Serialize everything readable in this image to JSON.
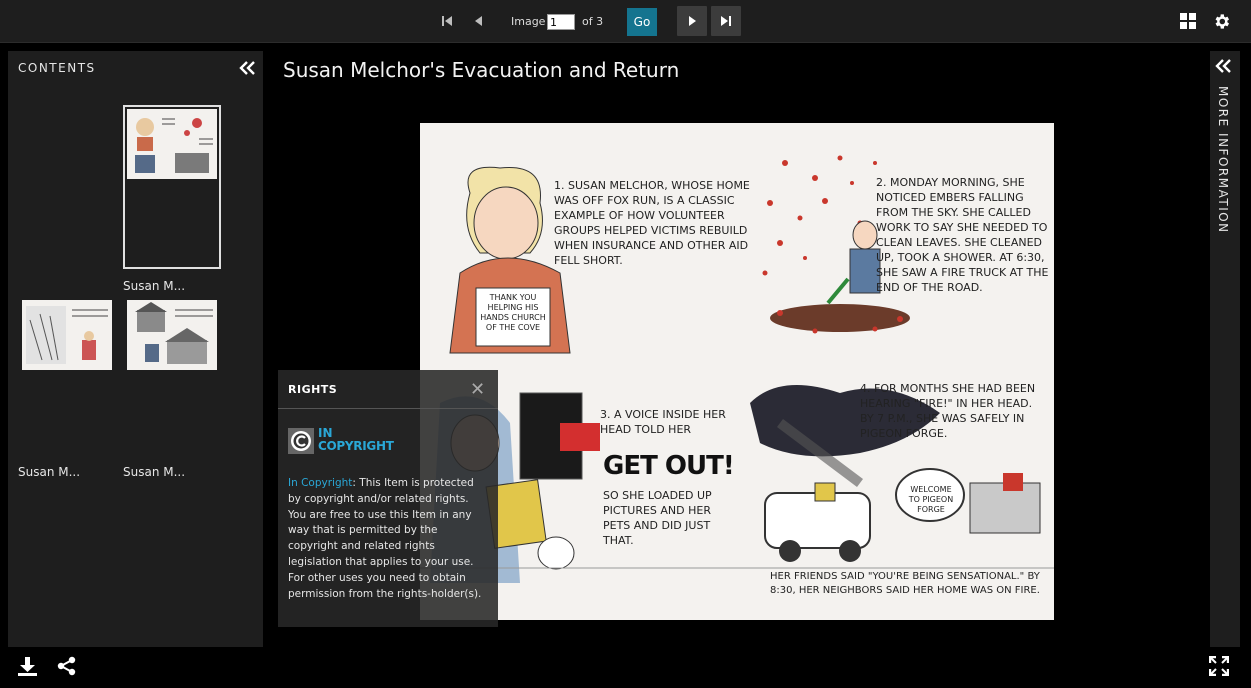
{
  "toolbar": {
    "image_label": "Image",
    "image_value": "1",
    "of_label": "of 3",
    "go_label": "Go"
  },
  "contents": {
    "title": "CONTENTS",
    "items": [
      {
        "label": "Susan M..."
      },
      {
        "label": "Susan M..."
      },
      {
        "label": "Susan M..."
      }
    ]
  },
  "document": {
    "title": "Susan Melchor's Evacuation and Return"
  },
  "artwork": {
    "panel1": "1. Susan Melchor, whose home was off Fox Run, is a classic example of how volunteer groups helped victims rebuild when insurance and other aid fell short.",
    "sign": "Thank you Helping His Hands Church of the Cove",
    "panel2": "2. Monday morning, she noticed embers falling from the sky. She called work to say she needed to clean leaves. She cleaned up, took a shower. At 6:30, she saw a fire truck at the end of the road.",
    "panel3": "3. A voice inside her head told her",
    "panel3_shout": "GET OUT!",
    "panel3_b": "So she loaded up pictures and her pets and did just that.",
    "panel4": "4. For months she had been hearing \"FIRE!\" in her head. By 7 P.M., she was safely in Pigeon Forge.",
    "road_sign": "Welcome to Pigeon Forge",
    "caption": "Her friends said \"You're being sensational.\" By 8:30, her neighbors said her home was on fire."
  },
  "rights": {
    "title": "RIGHTS",
    "badge_line1": "IN",
    "badge_line2": "COPYRIGHT",
    "link_text": "In Copyright",
    "body": ": This Item is protected by copyright and/or related rights. You are free to use this Item in any way that is permitted by the copyright and related rights legislation that applies to your use. For other uses you need to obtain permission from the rights-holder(s)."
  },
  "right_panel": {
    "title": "MORE INFORMATION"
  },
  "colors": {
    "accent": "#14748f",
    "link": "#2aa7d6",
    "panel_bg": "#1e1e1e"
  }
}
